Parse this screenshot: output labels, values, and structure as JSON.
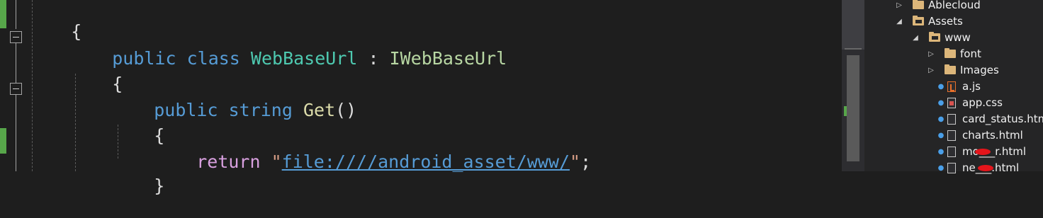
{
  "code_lines": [
    {
      "open_brace": "{"
    },
    {
      "kw_public": "public",
      "kw_class": "class",
      "class_name": "WebBaseUrl",
      "colon": ":",
      "interface_name": "IWebBaseUrl"
    },
    {
      "open_brace": "{"
    },
    {
      "kw_public": "public",
      "kw_string": "string",
      "method_name": "Get",
      "parens": "()"
    },
    {
      "open_brace": "{"
    },
    {
      "kw_return": "return",
      "quote_open": "\"",
      "url": "file:////android_asset/www/",
      "quote_close": "\"",
      "semicolon": ";"
    },
    {
      "close_brace": "}"
    }
  ],
  "solution_tree": [
    {
      "label": "Ablecloud",
      "icon": "folder-icon",
      "expander": "collapsed"
    },
    {
      "label": "Assets",
      "icon": "folder-open-icon",
      "expander": "expanded"
    },
    {
      "label": "www",
      "icon": "folder-open-icon",
      "expander": "expanded"
    },
    {
      "label": "font",
      "icon": "folder-icon",
      "expander": "collapsed"
    },
    {
      "label": "Images",
      "icon": "folder-icon",
      "expander": "collapsed"
    },
    {
      "label": "a.js",
      "icon": "js-file-icon"
    },
    {
      "label": "app.css",
      "icon": "css-file-icon"
    },
    {
      "label": "card_status.htm",
      "icon": "html-file-icon"
    },
    {
      "label": "charts.html",
      "icon": "html-file-icon"
    },
    {
      "label": "mo___r.html",
      "icon": "html-file-icon"
    },
    {
      "label": "ne___.html",
      "icon": "html-file-icon"
    }
  ],
  "colors": {
    "editor_bg": "#1e1e1e",
    "keyword": "#569cd6",
    "type": "#4ec9b0",
    "interface": "#b8d7a3",
    "method": "#dcdcaa",
    "control": "#d8a0df",
    "string": "#d69d85",
    "change_marker": "#57a64a",
    "folder": "#dcb67a",
    "redaction": "#e5151b"
  }
}
